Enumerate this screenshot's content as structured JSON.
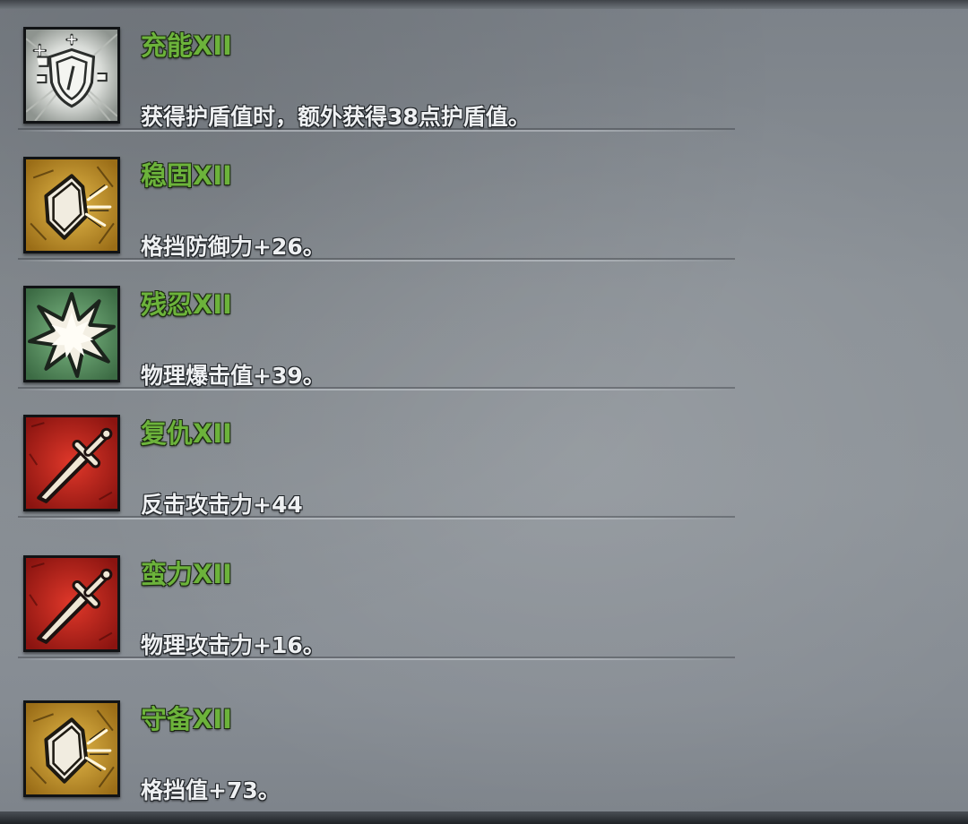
{
  "skills": [
    {
      "name": "充能XII",
      "description": "获得护盾值时，额外获得38点护盾值。",
      "icon": "shield-charge-icon",
      "icon_bg": "#d7dad6"
    },
    {
      "name": "稳固XII",
      "description": "格挡防御力+26。",
      "icon": "block-shield-icon",
      "icon_bg": "#c99a2e"
    },
    {
      "name": "残忍XII",
      "description": "物理爆击值+39。",
      "icon": "burst-star-icon",
      "icon_bg": "#5f9a68"
    },
    {
      "name": "复仇XII",
      "description": "反击攻击力+44",
      "icon": "sword-icon",
      "icon_bg": "#c3261c"
    },
    {
      "name": "蛮力XII",
      "description": "物理攻击力+16。",
      "icon": "sword-icon",
      "icon_bg": "#c3261c"
    },
    {
      "name": "守备XII",
      "description": "格挡值+73。",
      "icon": "block-shield-icon",
      "icon_bg": "#c99a2e"
    }
  ],
  "colors": {
    "skill_name": "#6cb33b",
    "description": "#eef0f2",
    "panel": "#868c93"
  }
}
